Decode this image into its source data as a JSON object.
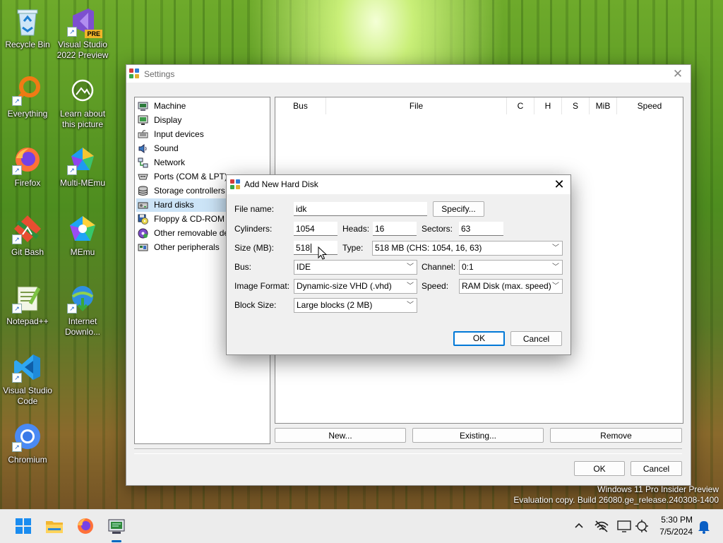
{
  "desktop": {
    "icons": [
      {
        "label": "Recycle Bin"
      },
      {
        "label": "Visual Studio 2022 Preview",
        "badge": "PRE"
      },
      {
        "label": "Everything"
      },
      {
        "label": "Learn about this picture"
      },
      {
        "label": "Firefox"
      },
      {
        "label": "Multi-MEmu"
      },
      {
        "label": "Git Bash"
      },
      {
        "label": "MEmu"
      },
      {
        "label": "Notepad++"
      },
      {
        "label": "Internet Downlo..."
      },
      {
        "label": "Visual Studio Code"
      },
      {
        "label": "Chromium"
      }
    ],
    "watermark": {
      "line1": "Windows 11 Pro Insider Preview",
      "line2": "Evaluation copy. Build 26080.ge_release.240308-1400"
    }
  },
  "settings": {
    "title": "Settings",
    "tree": [
      {
        "label": "Machine",
        "icon": "machine-icon"
      },
      {
        "label": "Display",
        "icon": "display-icon"
      },
      {
        "label": "Input devices",
        "icon": "input-devices-icon"
      },
      {
        "label": "Sound",
        "icon": "sound-icon"
      },
      {
        "label": "Network",
        "icon": "network-icon"
      },
      {
        "label": "Ports (COM & LPT)",
        "icon": "ports-icon"
      },
      {
        "label": "Storage controllers",
        "icon": "storage-icon"
      },
      {
        "label": "Hard disks",
        "icon": "hard-disk-icon",
        "selected": true
      },
      {
        "label": "Floppy & CD-ROM drives",
        "icon": "floppy-cdrom-icon"
      },
      {
        "label": "Other removable devices",
        "icon": "removable-icon"
      },
      {
        "label": "Other peripherals",
        "icon": "peripherals-icon"
      }
    ],
    "columns": [
      "Bus",
      "File",
      "C",
      "H",
      "S",
      "MiB",
      "Speed"
    ],
    "buttons": {
      "new": "New...",
      "existing": "Existing...",
      "remove": "Remove",
      "ok": "OK",
      "cancel": "Cancel"
    }
  },
  "dialog": {
    "title": "Add New Hard Disk",
    "file_name_label": "File name:",
    "file_name_value": "idk",
    "specify_label": "Specify...",
    "cylinders_label": "Cylinders:",
    "cylinders_value": "1054",
    "heads_label": "Heads:",
    "heads_value": "16",
    "sectors_label": "Sectors:",
    "sectors_value": "63",
    "size_label": "Size (MB):",
    "size_value": "518",
    "type_label": "Type:",
    "type_value": "518 MB (CHS: 1054, 16, 63)",
    "bus_label": "Bus:",
    "bus_value": "IDE",
    "channel_label": "Channel:",
    "channel_value": "0:1",
    "image_format_label": "Image Format:",
    "image_format_value": "Dynamic-size VHD (.vhd)",
    "speed_label": "Speed:",
    "speed_value": "RAM Disk (max. speed)",
    "block_size_label": "Block Size:",
    "block_size_value": "Large blocks (2 MB)",
    "ok": "OK",
    "cancel": "Cancel"
  },
  "taskbar": {
    "time": "5:30 PM",
    "date": "7/5/2024"
  }
}
